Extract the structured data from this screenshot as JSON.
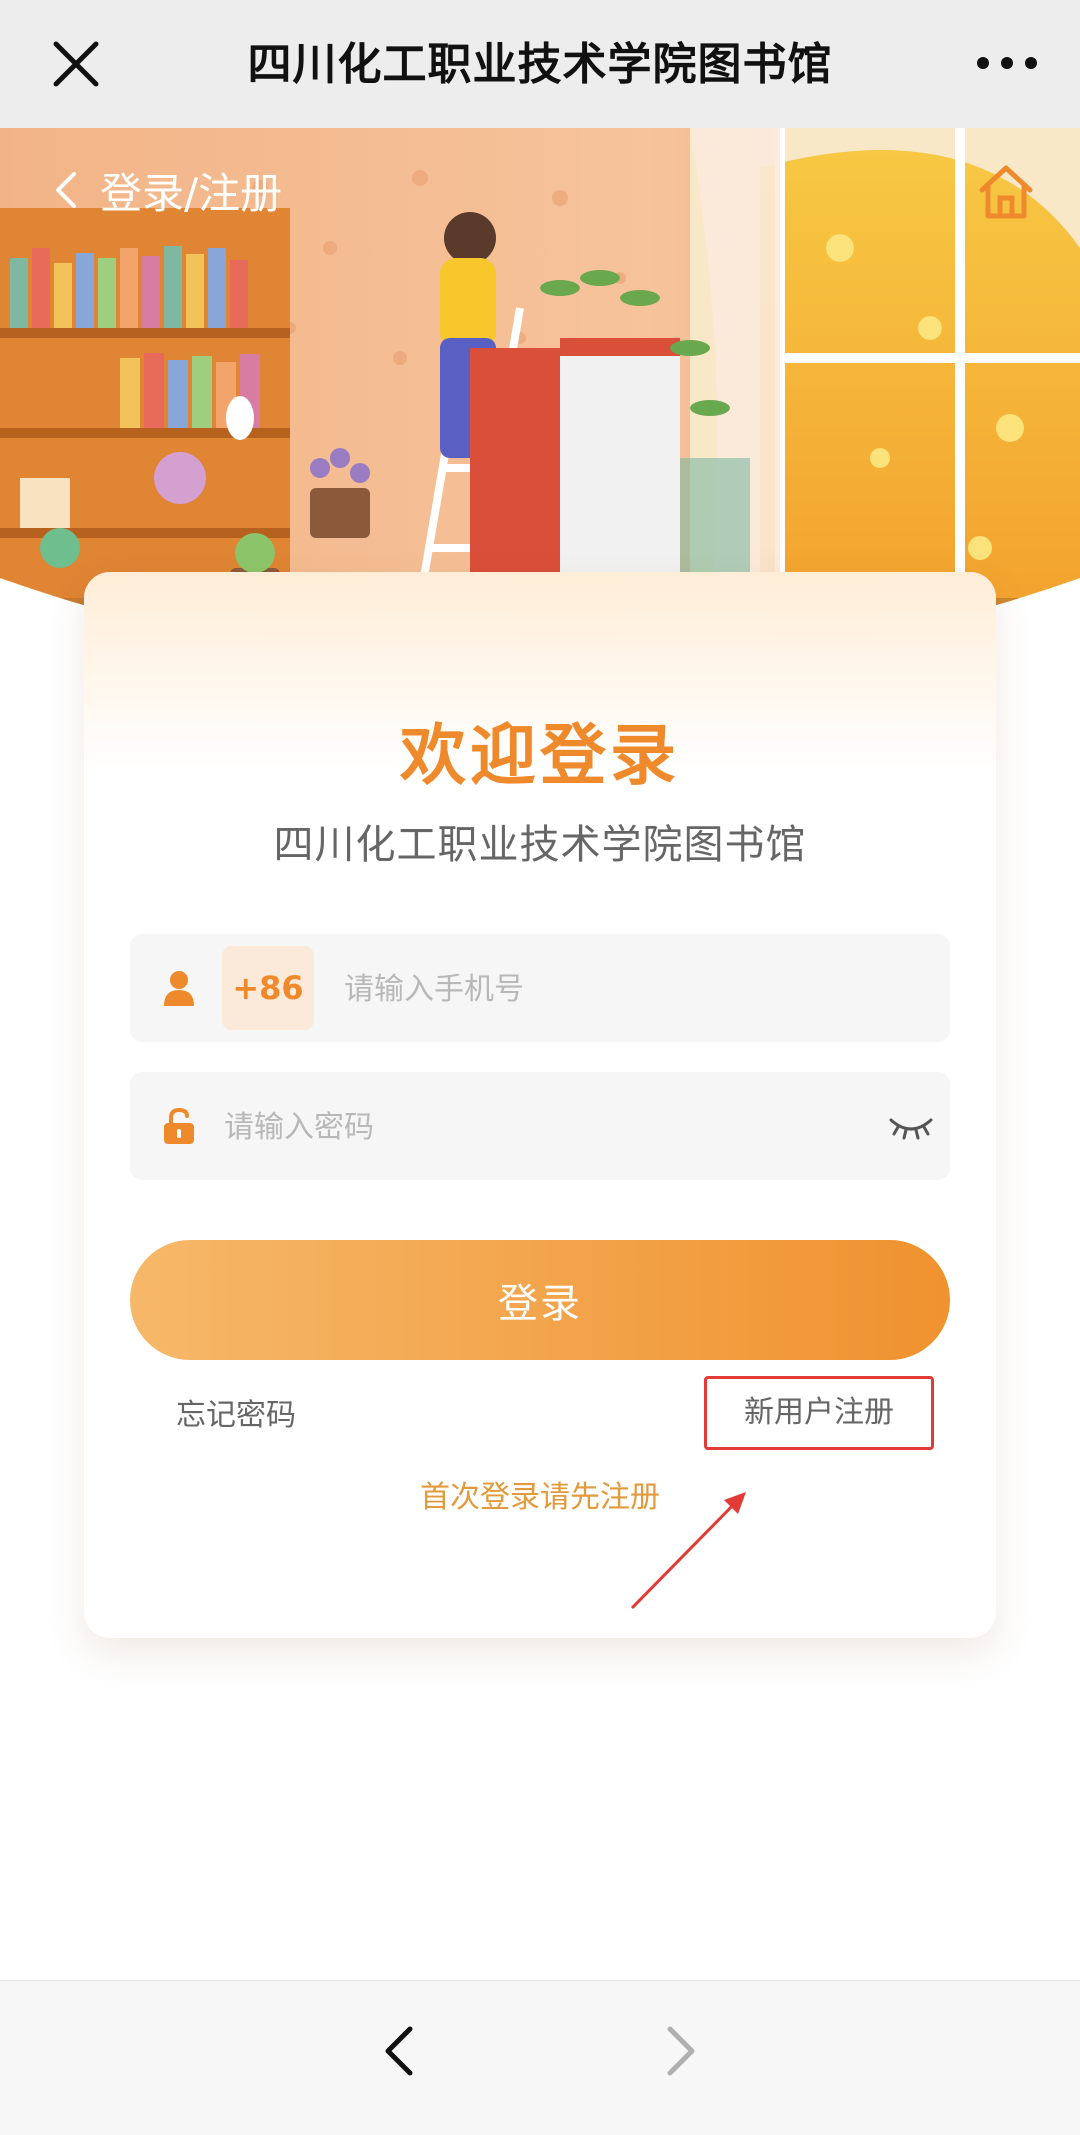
{
  "topbar": {
    "title": "四川化工职业技术学院图书馆",
    "close_icon": "close-icon",
    "more_icon": "more-icon"
  },
  "header": {
    "back_label": "登录/注册",
    "back_icon": "chevron-left-icon",
    "home_icon": "home-icon"
  },
  "card": {
    "welcome": "欢迎登录",
    "subtitle": "四川化工职业技术学院图书馆",
    "phone": {
      "country_code": "+86",
      "placeholder": "请输入手机号",
      "value": "",
      "icon": "user-icon"
    },
    "password": {
      "placeholder": "请输入密码",
      "value": "",
      "icon": "lock-icon",
      "toggle_icon": "eye-closed-icon"
    },
    "login_label": "登录",
    "forgot_label": "忘记密码",
    "register_label": "新用户注册",
    "hint": "首次登录请先注册"
  },
  "colors": {
    "accent": "#ef8a2c",
    "button_start": "#f6b869",
    "button_end": "#f0922f",
    "highlight_box": "#e23b36"
  },
  "bottombar": {
    "back_icon": "arrow-left-icon",
    "forward_icon": "arrow-right-icon"
  }
}
